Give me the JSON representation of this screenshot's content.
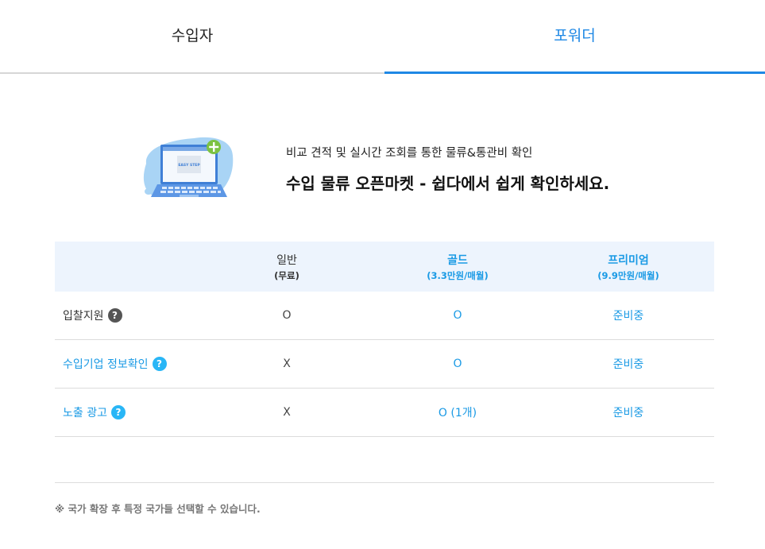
{
  "tabs": {
    "importer": "수입자",
    "forwarder": "포워더"
  },
  "hero": {
    "subtitle": "비교 견적 및 실시간 조회를 통한 물류&통관비 확인",
    "title": "수입 물류 오픈마켓 - 쉽다에서 쉽게 확인하세요.",
    "illustration_text": "EASY STEP",
    "illustration_icon": "laptop-icon"
  },
  "plans": {
    "normal": {
      "name": "일반",
      "price": "(무료)"
    },
    "gold": {
      "name": "골드",
      "price": "(3.3만원/매월)"
    },
    "premium": {
      "name": "프리미엄",
      "price": "(9.9만원/매월)"
    }
  },
  "rows": [
    {
      "label": "입찰지원",
      "normal": "O",
      "gold": "O",
      "premium": "준비중"
    },
    {
      "label": "수입기업 정보확인",
      "normal": "X",
      "gold": "O",
      "premium": "준비중"
    },
    {
      "label": "노출 광고",
      "normal": "X",
      "gold": "O (1개)",
      "premium": "준비중"
    }
  ],
  "help_icon_glyph": "?",
  "note": "※ 국가 확장 후 특정 국가들 선택할 수 있습니다.",
  "colors": {
    "accent": "#1e88e5",
    "header_bg": "#edf4fd",
    "help_icon_blue": "#29b6f6"
  }
}
